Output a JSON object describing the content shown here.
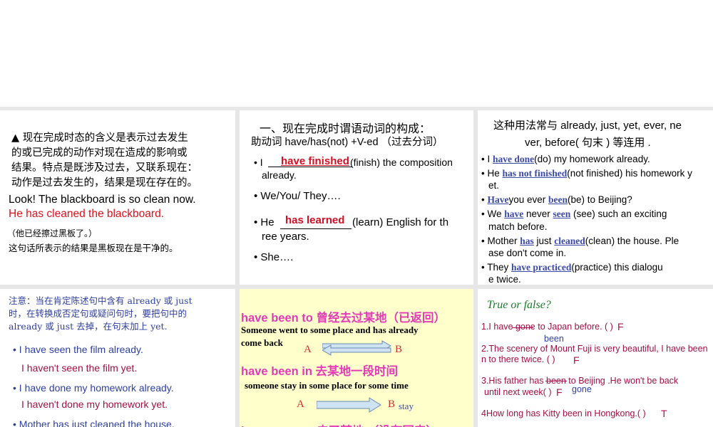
{
  "p1": {
    "intro": [
      "▲ 现在完成时态的含义是表示过去发生",
      "的或已完成的动作对现在造成的影响或",
      "结果。特点是既涉及过去，又联系现在：",
      "动作是过去发生的，结果是现在存在的。"
    ],
    "look": "Look! The blackboard is so clean now.",
    "red": "He has cleaned the blackboard.",
    "note1": "（他已经擦过黑板了。）",
    "note2": "这句话所表示的结果是黑板现在是干净的。"
  },
  "p2": {
    "title": "一、现在完成时谓语动词的构成：",
    "formula": "助动词 have/has(not) +V-ed （过去分词）",
    "l1a": "• I ",
    "l1ans": "have finished",
    "l1b": "(finish) the composition",
    "l1c": "already.",
    "l2": "• We/You/ They….",
    "l3a": "• He ",
    "l3ans": "has learned",
    "l3b": "(learn) English for th",
    "l3c": "ree years.",
    "l4": "• She…."
  },
  "p3": {
    "title1": "这种用法常与 already, just, yet, ever, ne",
    "title2": "ver, before( 句末 ) 等连用 .",
    "b1a": "I ",
    "b1ans": "have done",
    "b1b": "(do) my homework already.",
    "b2a": "He ",
    "b2ans": "has not finished",
    "b2b": "(not finished) his homework y",
    "b2c": "et.",
    "b3ans1": "Have",
    "b3a": "you ever ",
    "b3ans2": "been",
    "b3b": "(be) to Beijing?",
    "b4a": "We ",
    "b4ans1": "have",
    "b4b": " never ",
    "b4ans2": "seen",
    "b4c": " (see) such an exciting",
    "b4d": "match before.",
    "b5a": "Mother ",
    "b5ans1": "has",
    "b5b": " just ",
    "b5ans2": "cleaned",
    "b5c": "(clean) the house. Ple",
    "b5d": "ase don't come in.",
    "b6a": "They ",
    "b6ans": "have practiced",
    "b6b": "(practice) this dialogu",
    "b6c": "e twice."
  },
  "p4": {
    "note": [
      "注意：当在肯定陈述句中含有 already 或 just",
      "时，在转换成否定句或疑问句时，要把句中的",
      "already  或 just  去掉，在句末加上 yet."
    ],
    "s1": "I have seen the film already.",
    "s1n": "I haven't seen the film yet.",
    "s2": "I have done my homework already.",
    "s2n": "I haven't done my homework yet.",
    "s3": "Mother has just cleaned the house."
  },
  "p5": {
    "h1": "have been to  曾经去过某地（已返回）",
    "d1a": "Someone went  to some place and has already",
    "d1b": "come back",
    "a": "A",
    "b": "B",
    "h2": "have been in  去某地一段时间",
    "d2": "someone stay in some place for some time",
    "stay": "stay",
    "h3": "have gone to  去了某地    （没有回来）"
  },
  "p6": {
    "title": "True or false?",
    "q1": "1.I have gone to Japan before. (   )",
    "q1ans": "F",
    "q1fix": "been",
    "q2a": "2.The scenery of  Mount Fuji is very beautiful, I have       been",
    "q2b": "n to there twice. (     )",
    "q2ans": "F",
    "q3a": "3.His father has been to Beijing .He won't be back",
    "q3b": "until next week(     )",
    "q3ans": "F",
    "q3fix": "gone",
    "q4": "4How long has Kitty been in Hongkong.(      )",
    "q4ans": "T"
  }
}
